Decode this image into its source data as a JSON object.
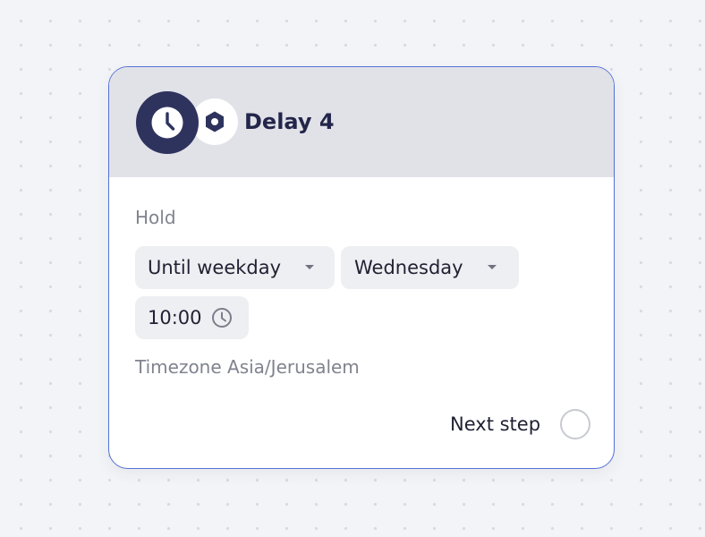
{
  "node": {
    "title": "Delay 4",
    "primary_icon": "clock-icon",
    "secondary_icon": "hexagon-nut-icon",
    "hold_label": "Hold",
    "condition": {
      "value": "Until weekday",
      "icon": "caret-down-icon"
    },
    "weekday": {
      "value": "Wednesday",
      "icon": "caret-down-icon"
    },
    "time": {
      "value": "10:00",
      "icon": "clock-icon"
    },
    "timezone_text": "Timezone Asia/Jerusalem",
    "next_step_label": "Next step",
    "next_step_connector_icon": "connector-circle-icon"
  },
  "colors": {
    "accent_border": "#5470d8",
    "header_bg": "#e1e2e8",
    "icon_badge": "#2e335e",
    "title_text": "#23264a",
    "muted_text": "#80838f",
    "pill_bg": "#eeeff2"
  }
}
